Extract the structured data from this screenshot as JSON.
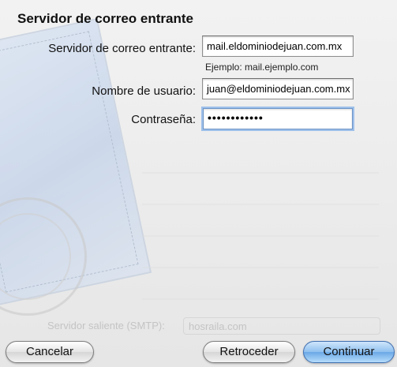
{
  "dialog": {
    "title": "Servidor de correo entrante"
  },
  "form": {
    "server_label": "Servidor de correo entrante:",
    "server_value": "mail.eldominiodejuan.com.mx",
    "server_hint": "Ejemplo: mail.ejemplo.com",
    "username_label": "Nombre de usuario:",
    "username_value": "juan@eldominiodejuan.com.mx",
    "password_label": "Contraseña:",
    "password_value": "••••••••••••"
  },
  "background": {
    "smtp_label": "Servidor saliente (SMTP):",
    "smtp_value": "hosraila.com"
  },
  "buttons": {
    "cancel": "Cancelar",
    "back": "Retroceder",
    "continue": "Continuar"
  },
  "colors": {
    "primary_button": "#6aa8e6",
    "focus_ring": "#9ec0ea"
  }
}
